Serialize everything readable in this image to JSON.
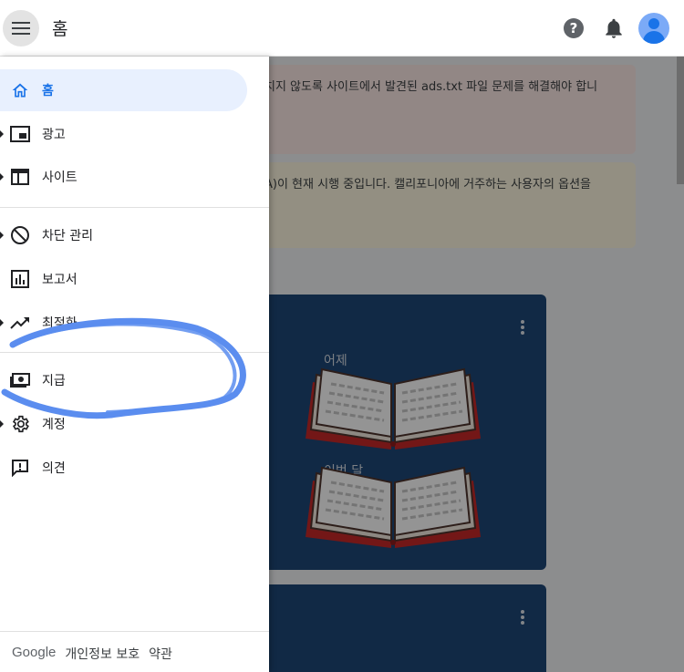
{
  "header": {
    "title": "홈",
    "menu_icon": "hamburger-menu-icon",
    "help_icon": "help-circle-icon",
    "help_glyph": "?",
    "notification_icon": "bell-icon",
    "account_icon": "avatar-icon"
  },
  "sidebar": {
    "items": [
      {
        "label": "홈",
        "icon": "home-icon",
        "active": true
      },
      {
        "label": "광고",
        "icon": "ads-icon"
      },
      {
        "label": "사이트",
        "icon": "sites-icon"
      },
      {
        "label": "차단 관리",
        "icon": "block-icon"
      },
      {
        "label": "보고서",
        "icon": "reports-icon"
      },
      {
        "label": "최적화",
        "icon": "trending-up-icon"
      },
      {
        "label": "지급",
        "icon": "payments-icon"
      },
      {
        "label": "계정",
        "icon": "gear-icon"
      },
      {
        "label": "의견",
        "icon": "feedback-icon"
      }
    ],
    "footer": {
      "brand": "Google",
      "privacy": "개인정보 보호",
      "terms": "약관"
    }
  },
  "main": {
    "notices": [
      {
        "text": "치지 않도록 사이트에서 발견된 ads.txt 파일 문제를 해결해야 합니"
      },
      {
        "text": "A)이 현재 시행 중입니다. 캘리포니아에 거주하는 사용자의 옵션을"
      }
    ],
    "card": {
      "label_yesterday": "어제",
      "label_this_month": "이번 달"
    }
  },
  "colors": {
    "accent": "#1a73e8",
    "card_bg": "#1e4778",
    "highlight_stroke": "#5b8def",
    "active_nav_bg": "#e8f0fe"
  }
}
